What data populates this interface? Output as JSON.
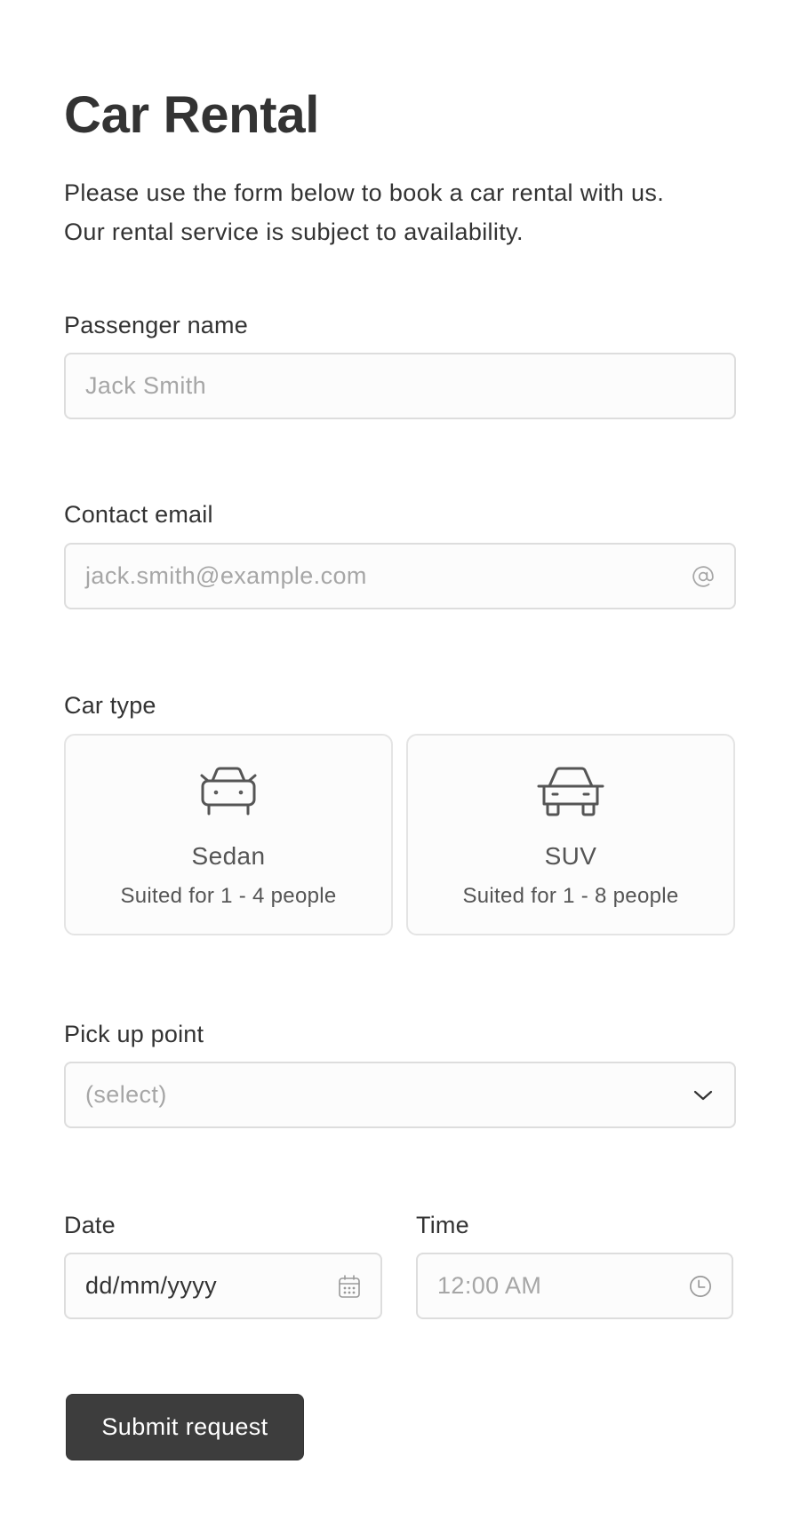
{
  "header": {
    "title": "Car Rental",
    "intro_lines": [
      "Please use the form below to book a car rental with us.",
      "Our rental service is subject to availability."
    ]
  },
  "form": {
    "passenger_name": {
      "label": "Passenger name",
      "placeholder": "Jack Smith",
      "value": ""
    },
    "contact_email": {
      "label": "Contact email",
      "placeholder": "jack.smith@example.com",
      "value": "",
      "icon": "at-sign-icon"
    },
    "car_type": {
      "label": "Car type",
      "options": [
        {
          "title": "Sedan",
          "subtitle": "Suited for 1 - 4 people",
          "icon": "sedan-car-icon",
          "selected": false
        },
        {
          "title": "SUV",
          "subtitle": "Suited for 1 - 8 people",
          "icon": "suv-car-icon",
          "selected": false
        }
      ]
    },
    "pickup_point": {
      "label": "Pick up point",
      "selected": "(select)",
      "icon": "chevron-down-icon"
    },
    "date": {
      "label": "Date",
      "value": "dd/mm/yyyy",
      "icon": "calendar-icon"
    },
    "time": {
      "label": "Time",
      "placeholder": "12:00 AM",
      "icon": "clock-icon"
    },
    "submit_label": "Submit request"
  },
  "colors": {
    "text": "#333333",
    "placeholder": "#a6a6a6",
    "border": "#dddddd",
    "button_bg": "#3d3d3d",
    "button_text": "#ffffff"
  }
}
